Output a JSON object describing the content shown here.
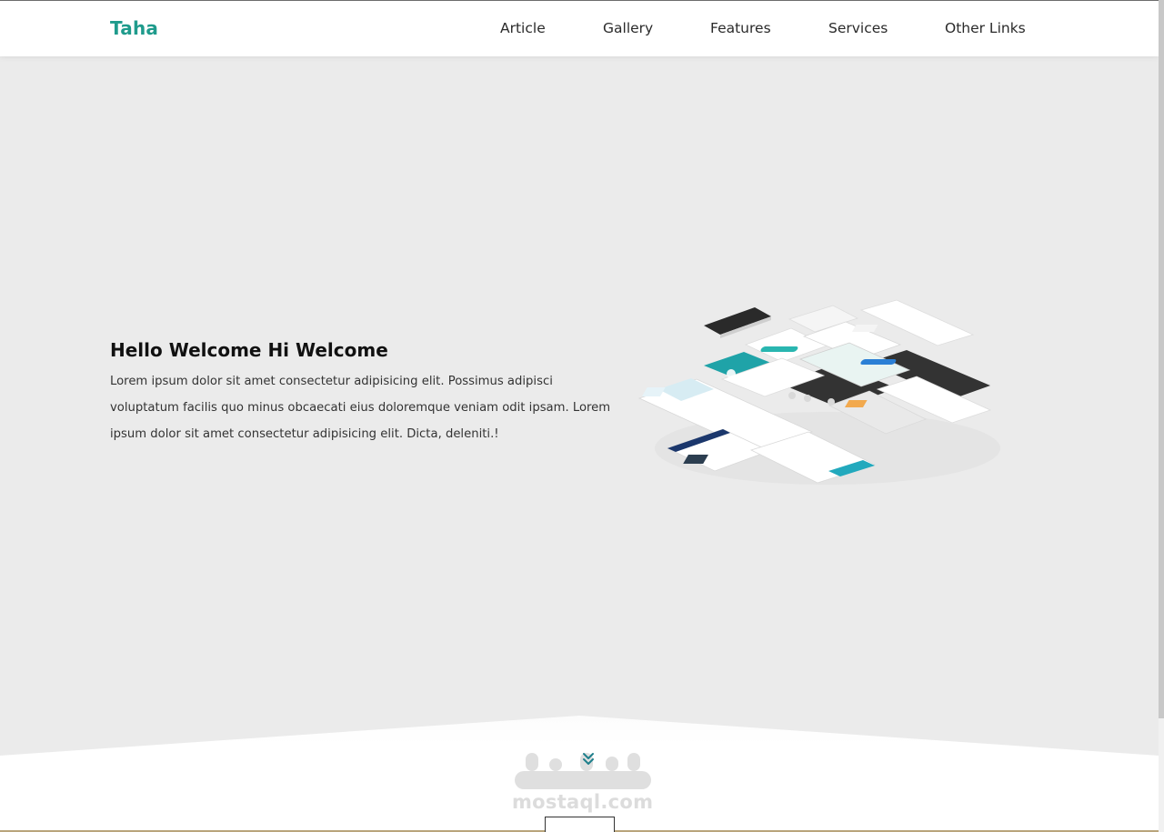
{
  "header": {
    "logo": "Taha",
    "nav": [
      "Article",
      "Gallery",
      "Features",
      "Services",
      "Other Links"
    ]
  },
  "hero": {
    "title": "Hello Welcome Hi Welcome",
    "text": "Lorem ipsum dolor sit amet consectetur adipisicing elit. Possimus adipisci voluptatum facilis quo minus obcaecati eius doloremque veniam odit ipsam. Lorem ipsum dolor sit amet consectetur adipisicing elit. Dicta, deleniti.!",
    "image": "isometric-website-mockups"
  },
  "watermark": {
    "text": "mostaql.com"
  },
  "icons": {
    "scroll_down": "double-chevron-down-icon"
  },
  "colors": {
    "brand": "#1f9b8c",
    "hero_bg": "#ebebeb",
    "text": "#333333"
  }
}
